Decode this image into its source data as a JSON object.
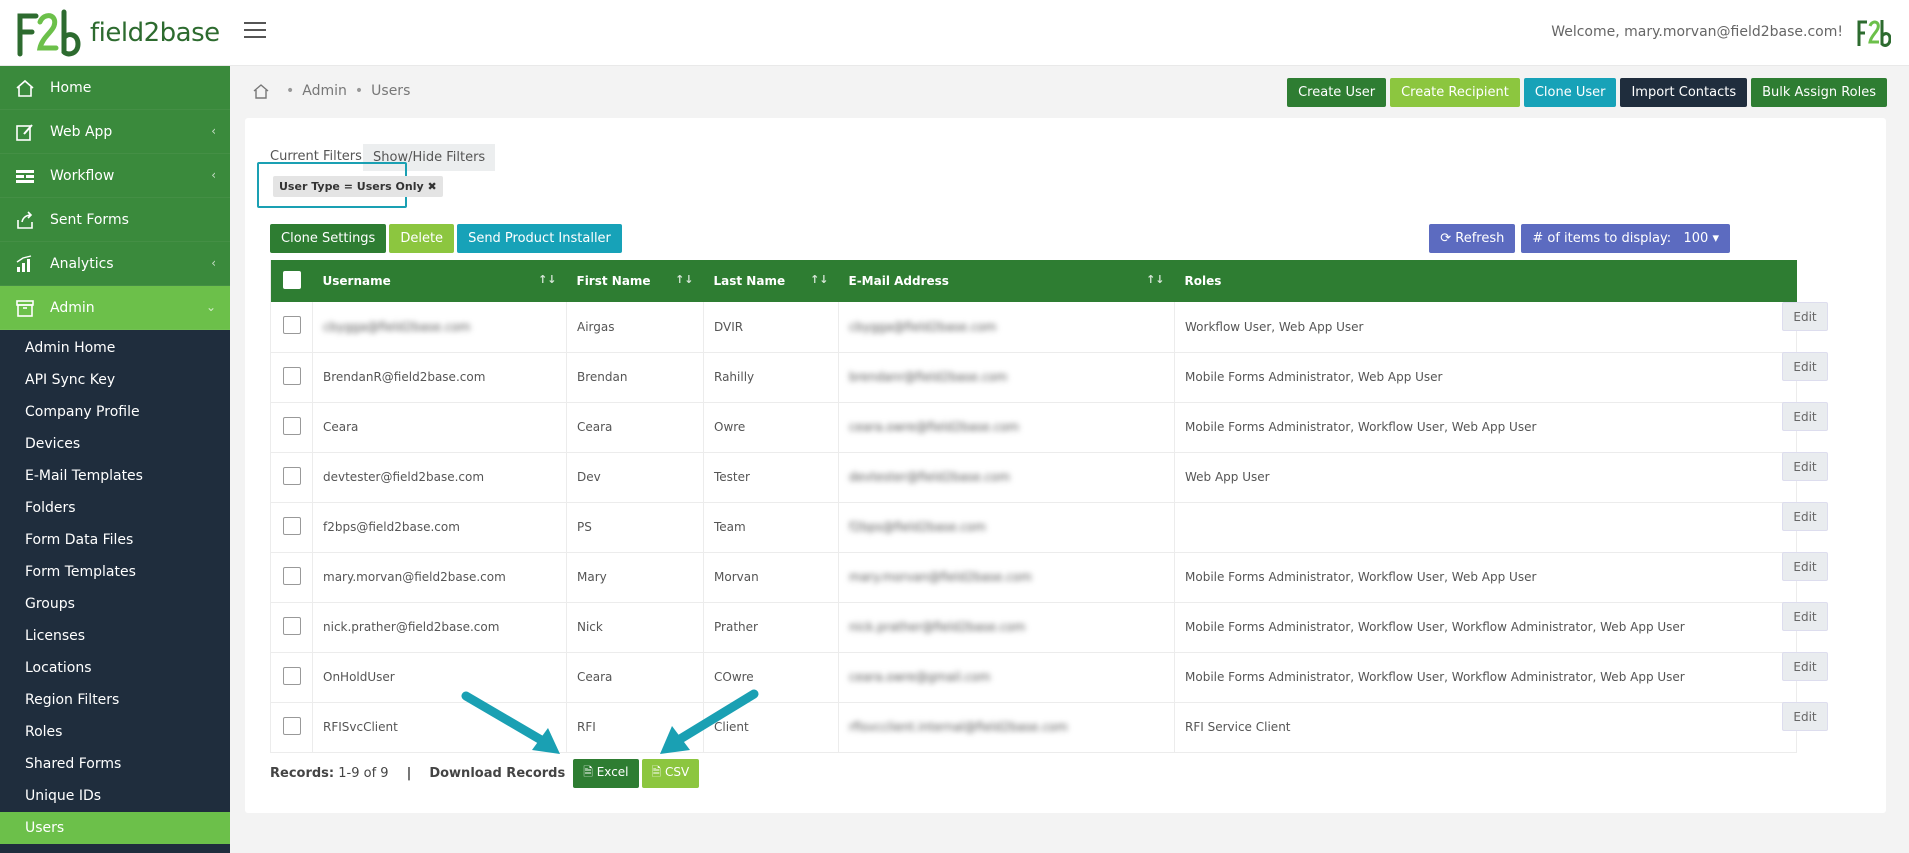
{
  "header": {
    "brand": "field2base",
    "welcome": "Welcome, mary.morvan@field2base.com!"
  },
  "sidebar": {
    "main": [
      {
        "label": "Home",
        "icon": "home-icon"
      },
      {
        "label": "Web App",
        "icon": "edit-icon"
      },
      {
        "label": "Workflow",
        "icon": "workflow-icon"
      },
      {
        "label": "Sent Forms",
        "icon": "share-icon"
      },
      {
        "label": "Analytics",
        "icon": "analytics-icon"
      },
      {
        "label": "Admin",
        "icon": "archive-icon"
      }
    ],
    "sub": [
      "Admin Home",
      "API Sync Key",
      "Company Profile",
      "Devices",
      "E-Mail Templates",
      "Folders",
      "Form Data Files",
      "Form Templates",
      "Groups",
      "Licenses",
      "Locations",
      "Region Filters",
      "Roles",
      "Shared Forms",
      "Unique IDs",
      "Users"
    ]
  },
  "breadcrumb": [
    "Admin",
    "Users"
  ],
  "top_actions": [
    "Create User",
    "Create Recipient",
    "Clone User",
    "Import Contacts",
    "Bulk Assign Roles"
  ],
  "filters": {
    "label": "Current Filters:",
    "toggle": "Show/Hide Filters",
    "chip": "User Type = Users Only"
  },
  "row_actions": [
    "Clone Settings",
    "Delete",
    "Send Product Installer"
  ],
  "controls": {
    "refresh": "Refresh",
    "items_label": "# of items to display:",
    "items_value": "100"
  },
  "table": {
    "columns": [
      "Username",
      "First Name",
      "Last Name",
      "E-Mail Address",
      "Roles"
    ],
    "rows": [
      {
        "username": "cbygga@field2base.com",
        "username_blurred": true,
        "first": "Airgas",
        "last": "DVIR",
        "email": "cbygga@field2base.com",
        "roles": "Workflow User, Web App User"
      },
      {
        "username": "BrendanR@field2base.com",
        "username_blurred": false,
        "first": "Brendan",
        "last": "Rahilly",
        "email": "brendanr@field2base.com",
        "roles": "Mobile Forms Administrator, Web App User"
      },
      {
        "username": "Ceara",
        "username_blurred": false,
        "first": "Ceara",
        "last": "Owre",
        "email": "ceara.owre@field2base.com",
        "roles": "Mobile Forms Administrator, Workflow User, Web App User"
      },
      {
        "username": "devtester@field2base.com",
        "username_blurred": false,
        "first": "Dev",
        "last": "Tester",
        "email": "devtester@field2base.com",
        "roles": "Web App User"
      },
      {
        "username": "f2bps@field2base.com",
        "username_blurred": false,
        "first": "PS",
        "last": "Team",
        "email": "f2bps@field2base.com",
        "roles": ""
      },
      {
        "username": "mary.morvan@field2base.com",
        "username_blurred": false,
        "first": "Mary",
        "last": "Morvan",
        "email": "mary.morvan@field2base.com",
        "roles": "Mobile Forms Administrator, Workflow User, Web App User"
      },
      {
        "username": "nick.prather@field2base.com",
        "username_blurred": false,
        "first": "Nick",
        "last": "Prather",
        "email": "nick.prather@field2base.com",
        "roles": "Mobile Forms Administrator, Workflow User, Workflow Administrator, Web App User"
      },
      {
        "username": "OnHoldUser",
        "username_blurred": false,
        "first": "Ceara",
        "last": "COwre",
        "email": "ceara.owre@gmail.com",
        "roles": "Mobile Forms Administrator, Workflow User, Workflow Administrator, Web App User"
      },
      {
        "username": "RFISvcClient",
        "username_blurred": false,
        "first": "RFI",
        "last": "Client",
        "email": "rfisvcclient.internal@field2base.com",
        "roles": "RFI Service Client"
      }
    ],
    "edit_label": "Edit"
  },
  "footer": {
    "records_label": "Records:",
    "records_value": "1-9 of 9",
    "divider": "|",
    "download_label": "Download Records",
    "excel": "Excel",
    "csv": "CSV"
  },
  "colors": {
    "dark_green": "#2e7d32",
    "light_green": "#8cc63f",
    "teal": "#17a2b8",
    "navy": "#1f2d3d",
    "purple": "#5c6bc0",
    "annotation": "#1aa0b3"
  }
}
